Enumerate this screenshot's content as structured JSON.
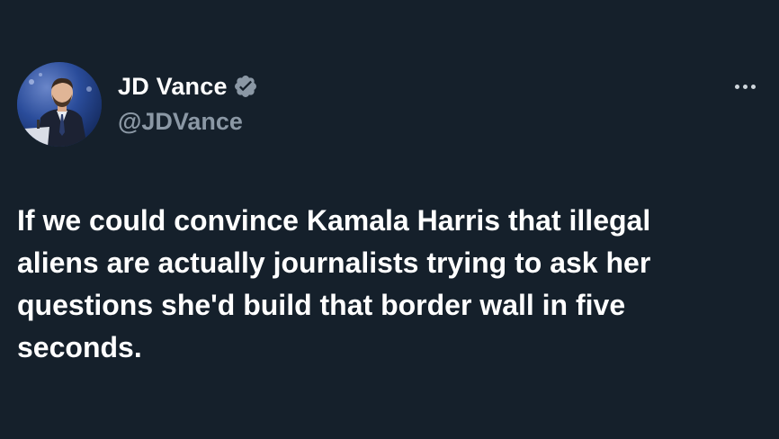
{
  "tweet": {
    "author": {
      "display_name": "JD Vance",
      "handle": "@JDVance",
      "verified": true
    },
    "text": "If we could convince Kamala Harris that illegal\naliens are actually journalists trying to ask her\nquestions she'd build that border wall in five\nseconds.",
    "more_icon": "more-dots-icon",
    "verified_icon": "verified-badge-icon"
  },
  "colors": {
    "background": "#15202b",
    "text_primary": "#ffffff",
    "text_secondary": "#8b98a5",
    "badge": "#8b98a5"
  }
}
